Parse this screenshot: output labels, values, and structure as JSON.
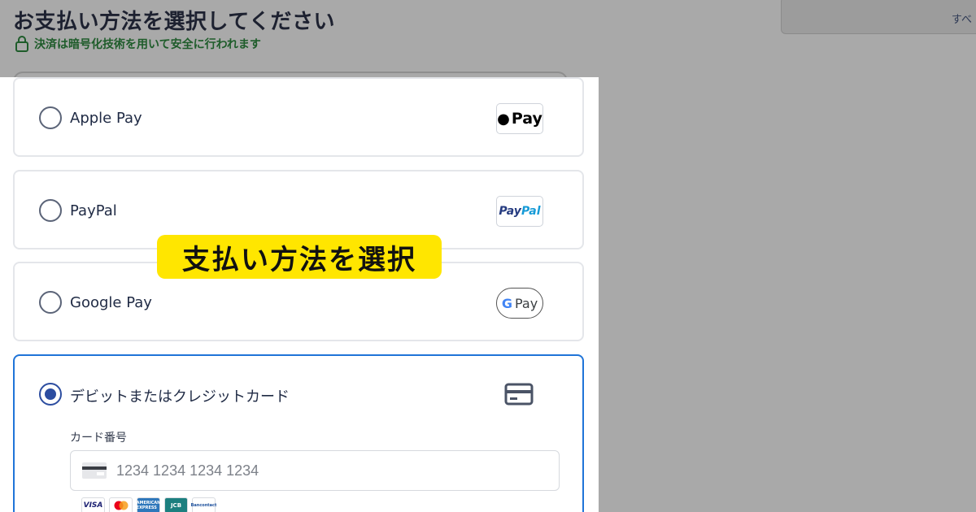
{
  "header": {
    "title": "お支払い方法を選択してください",
    "secure_note": "決済は暗号化技術を用いて安全に行われます"
  },
  "right_panel": {
    "text": "すべ"
  },
  "payment_options": [
    {
      "id": "apple-pay",
      "label": "Apple Pay",
      "logo_text": "Pay",
      "selected": false
    },
    {
      "id": "paypal",
      "label": "PayPal",
      "logo_text_1": "Pay",
      "logo_text_2": "Pal",
      "selected": false
    },
    {
      "id": "google-pay",
      "label": "Google Pay",
      "logo_text": "Pay",
      "selected": false
    },
    {
      "id": "card",
      "label": "デビットまたはクレジットカード",
      "selected": true
    }
  ],
  "card_form": {
    "number_label": "カード番号",
    "number_placeholder": "1234 1234 1234 1234",
    "brands": [
      "VISA",
      "AMERICAN EXPRESS",
      "JCB",
      "Bancontact"
    ]
  },
  "banner": {
    "text": "支払い方法を選択"
  },
  "colors": {
    "selected_border": "#1f74d8",
    "radio_checked": "#2c4da0",
    "secure_green": "#1e5c2a",
    "banner_yellow": "#ffe600"
  }
}
